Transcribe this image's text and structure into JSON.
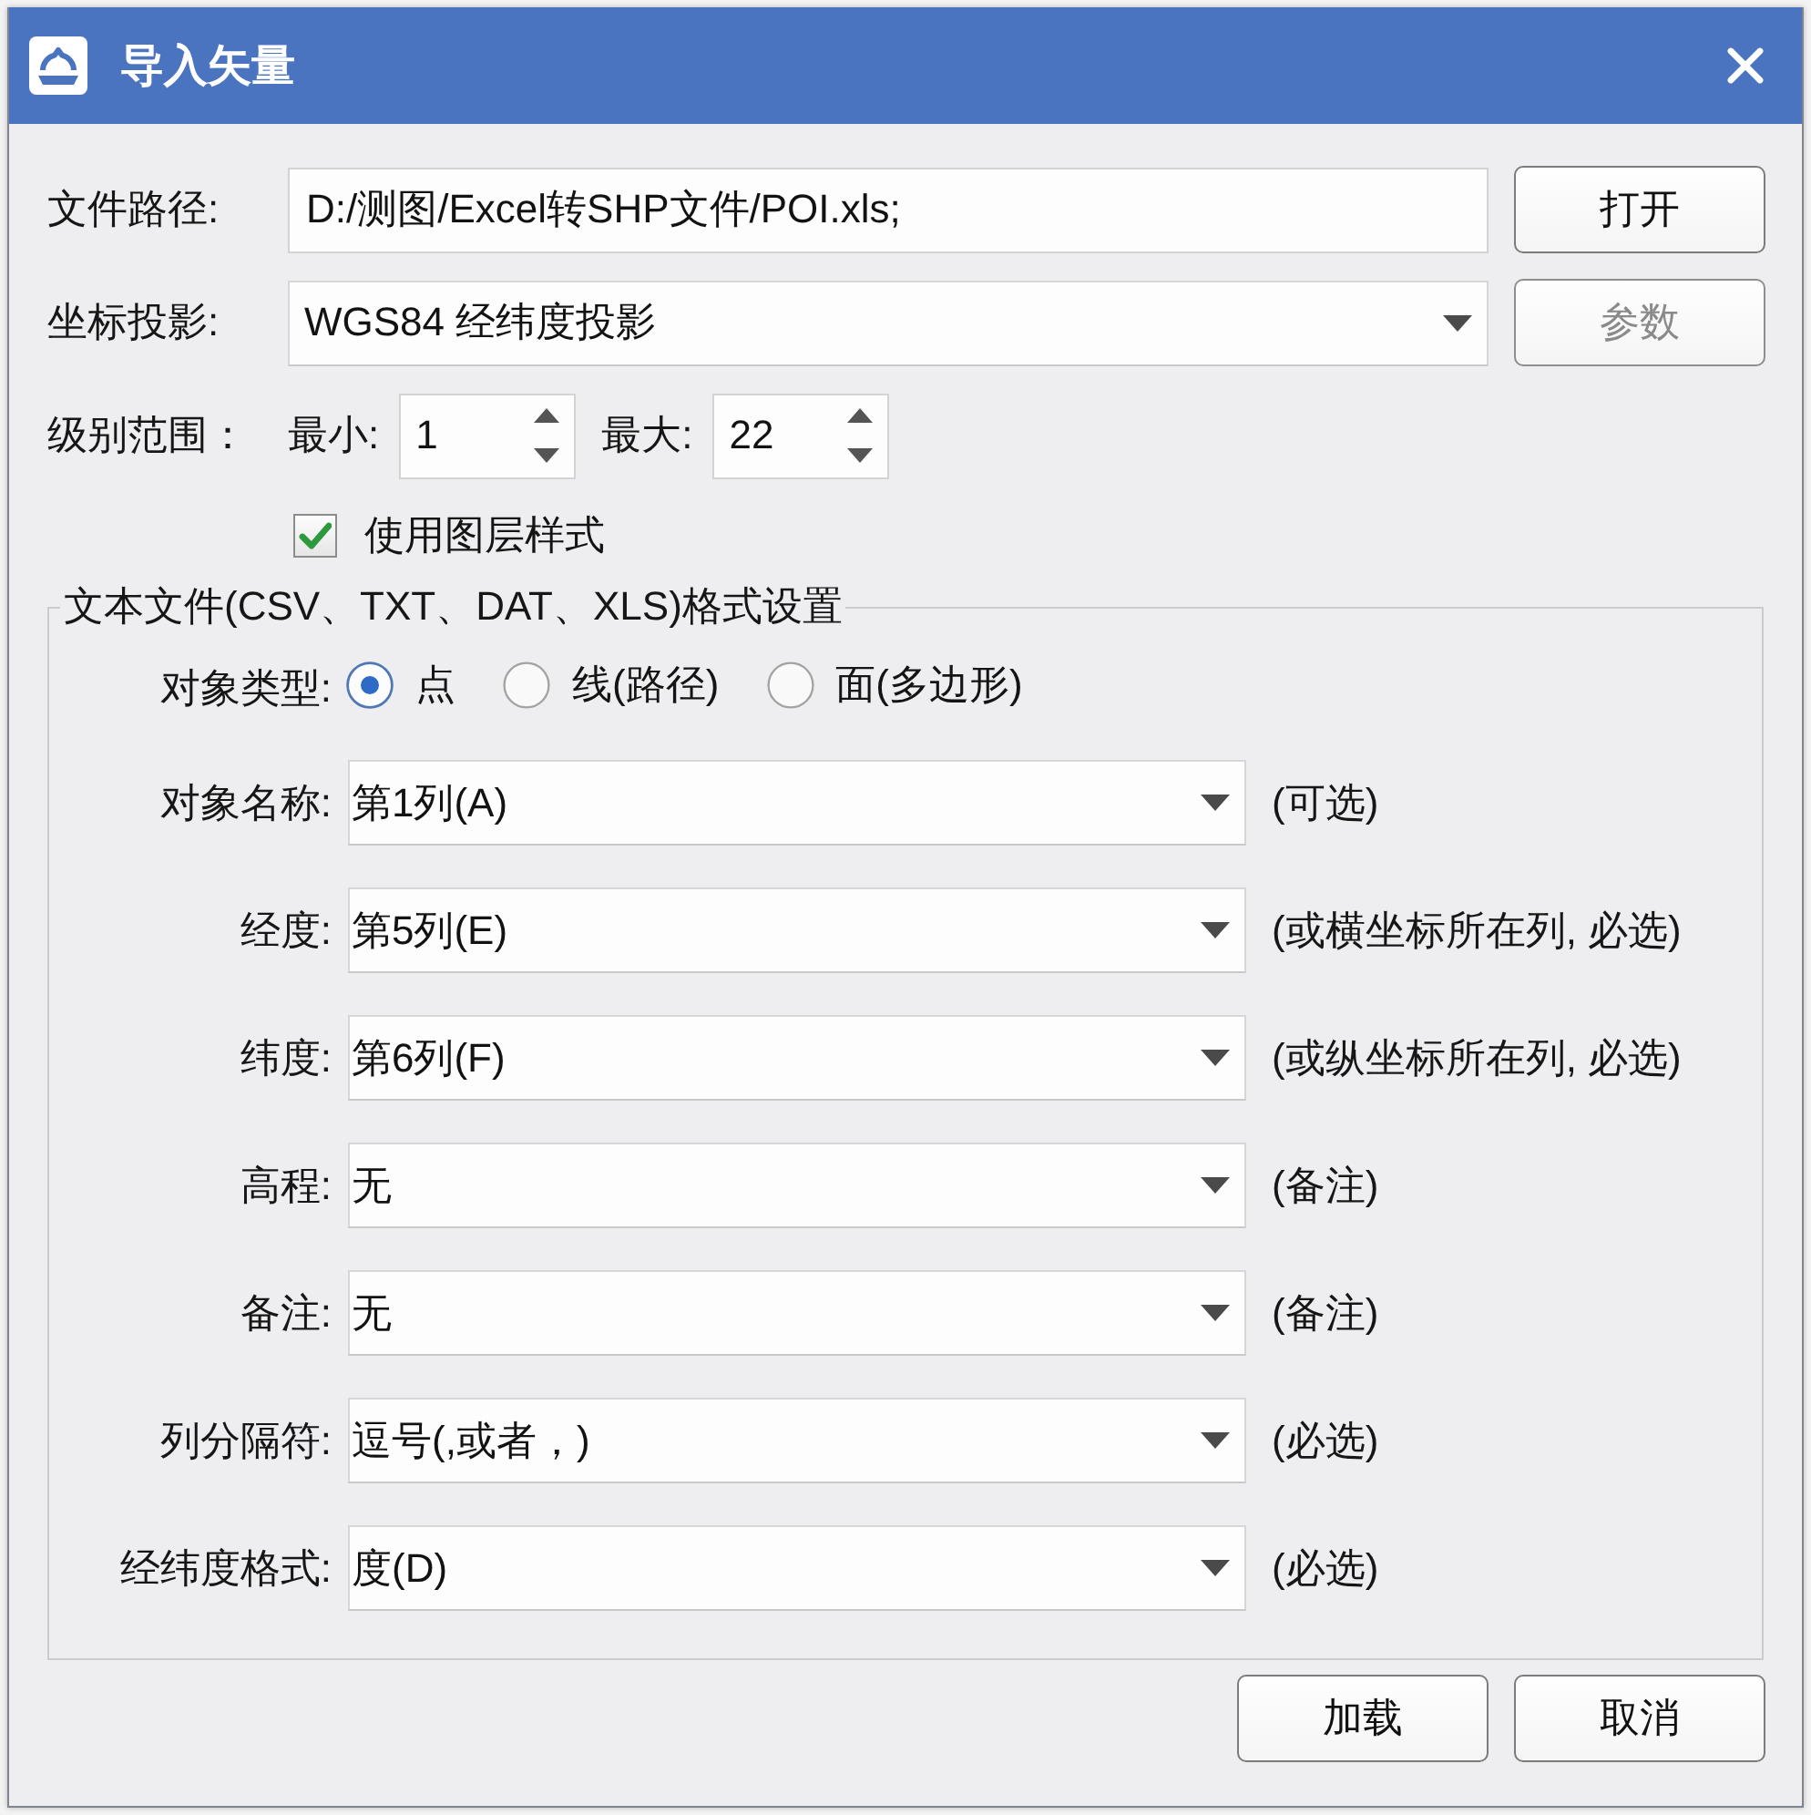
{
  "window": {
    "title": "导入矢量"
  },
  "file_path": {
    "label": "文件路径:",
    "value": "D:/测图/Excel转SHP文件/POI.xls;",
    "button": {
      "label": "打开",
      "disabled": false
    }
  },
  "projection": {
    "label": "坐标投影:",
    "value": "WGS84 经纬度投影",
    "button": {
      "label": "参数",
      "disabled": true
    }
  },
  "level_range": {
    "label": "级别范围：",
    "min": {
      "label": "最小:",
      "value": "1"
    },
    "max": {
      "label": "最大:",
      "value": "22"
    }
  },
  "use_layer_style": {
    "label": "使用图层样式",
    "checked": true
  },
  "text_format": {
    "title": "文本文件(CSV、TXT、DAT、XLS)格式设置",
    "object_type": {
      "label": "对象类型:",
      "options": [
        {
          "label": "点",
          "selected": true
        },
        {
          "label": "线(路径)",
          "selected": false
        },
        {
          "label": "面(多边形)",
          "selected": false
        }
      ]
    },
    "fields": [
      {
        "label": "对象名称:",
        "value": "第1列(A)",
        "note": "(可选)"
      },
      {
        "label": "经度:",
        "value": "第5列(E)",
        "note": "(或横坐标所在列, 必选)"
      },
      {
        "label": "纬度:",
        "value": "第6列(F)",
        "note": "(或纵坐标所在列, 必选)"
      },
      {
        "label": "高程:",
        "value": "无",
        "note": "(备注)"
      },
      {
        "label": "备注:",
        "value": "无",
        "note": "(备注)"
      },
      {
        "label": "列分隔符:",
        "value": "逗号(,或者，)",
        "note": "(必选)"
      },
      {
        "label": "经纬度格式:",
        "value": "度(D)",
        "note": "(必选)"
      }
    ]
  },
  "buttons": [
    {
      "label": "加载"
    },
    {
      "label": "取消"
    }
  ]
}
